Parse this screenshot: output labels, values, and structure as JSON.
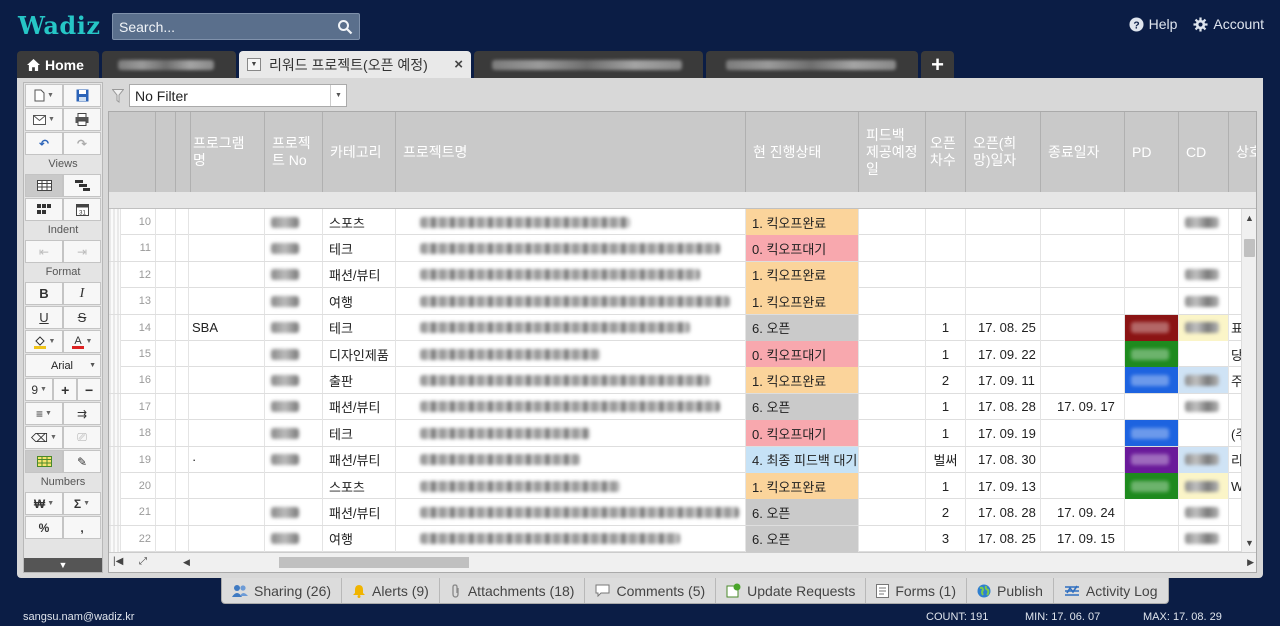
{
  "app": {
    "logo": "Wadiz"
  },
  "search": {
    "placeholder": "Search..."
  },
  "top_links": {
    "help": "Help",
    "account": "Account"
  },
  "tabs": {
    "home": "Home",
    "active": "리워드 프로젝트(오픈 예정)"
  },
  "filter": {
    "value": "No Filter"
  },
  "toolbar": {
    "views": "Views",
    "indent": "Indent",
    "format": "Format",
    "font": "Arial",
    "font_size": "9",
    "numbers": "Numbers"
  },
  "columns": [
    "프로그램명",
    "프로젝트 No",
    "카테고리",
    "프로젝트명",
    "현 진행상태",
    "피드백 제공예정일",
    "오픈차수",
    "오픈(희망)일자",
    "종료일자",
    "PD",
    "CD",
    "상호"
  ],
  "rows": [
    {
      "num": "10",
      "program": "",
      "category": "스포츠",
      "status": "1. 킥오프완료",
      "status_type": "kick-done",
      "round": "",
      "open": "",
      "end": "",
      "pd": "",
      "cd": "blur",
      "extra": ""
    },
    {
      "num": "11",
      "program": "",
      "category": "테크",
      "status": "0. 킥오프대기",
      "status_type": "kick-wait",
      "round": "",
      "open": "",
      "end": "",
      "pd": "",
      "cd": "",
      "extra": ""
    },
    {
      "num": "12",
      "program": "",
      "category": "패션/뷰티",
      "status": "1. 킥오프완료",
      "status_type": "kick-done",
      "round": "",
      "open": "",
      "end": "",
      "pd": "",
      "cd": "blur",
      "extra": ""
    },
    {
      "num": "13",
      "program": "",
      "category": "여행",
      "status": "1. 킥오프완료",
      "status_type": "kick-done",
      "round": "",
      "open": "",
      "end": "",
      "pd": "",
      "cd": "blur",
      "extra": ""
    },
    {
      "num": "14",
      "program": "SBA",
      "category": "테크",
      "status": "6. 오픈",
      "status_type": "open",
      "round": "1",
      "open": "17. 08. 25",
      "end": "",
      "pd": "#8b1414",
      "cd": "#fbf5c8",
      "extra": "표"
    },
    {
      "num": "15",
      "program": "",
      "category": "디자인제품",
      "status": "0. 킥오프대기",
      "status_type": "kick-wait",
      "round": "1",
      "open": "17. 09. 22",
      "end": "",
      "pd": "#1e8a1e",
      "cd": "",
      "extra": "당"
    },
    {
      "num": "16",
      "program": "",
      "category": "출판",
      "status": "1. 킥오프완료",
      "status_type": "kick-done",
      "round": "2",
      "open": "17. 09. 11",
      "end": "",
      "pd": "#1d63e0",
      "cd": "#cfe3f5",
      "extra": "주"
    },
    {
      "num": "17",
      "program": "",
      "category": "패션/뷰티",
      "status": "6. 오픈",
      "status_type": "open",
      "round": "1",
      "open": "17. 08. 28",
      "end": "17. 09. 17",
      "pd": "",
      "cd": "blur",
      "extra": ""
    },
    {
      "num": "18",
      "program": "",
      "category": "테크",
      "status": "0. 킥오프대기",
      "status_type": "kick-wait",
      "round": "1",
      "open": "17. 09. 19",
      "end": "",
      "pd": "#1d63e0",
      "cd": "",
      "extra": "(주"
    },
    {
      "num": "19",
      "program": "·",
      "category": "패션/뷰티",
      "status": "4. 최종 피드백 대기",
      "status_type": "feedback",
      "round": "벌써",
      "open": "17. 08. 30",
      "end": "",
      "pd": "#6a1a9a",
      "cd": "#cfe3f5",
      "extra": "리"
    },
    {
      "num": "20",
      "program": "",
      "category": "스포츠",
      "status": "1. 킥오프완료",
      "status_type": "kick-done",
      "round": "1",
      "open": "17. 09. 13",
      "end": "",
      "pd": "#1e8a1e",
      "cd": "#fbf5c8",
      "extra": "W"
    },
    {
      "num": "21",
      "program": "",
      "category": "패션/뷰티",
      "status": "6. 오픈",
      "status_type": "open",
      "round": "2",
      "open": "17. 08. 28",
      "end": "17. 09. 24",
      "pd": "",
      "cd": "blur",
      "extra": ""
    },
    {
      "num": "22",
      "program": "",
      "category": "여행",
      "status": "6. 오픈",
      "status_type": "open",
      "round": "3",
      "open": "17. 08. 25",
      "end": "17. 09. 15",
      "pd": "",
      "cd": "blur",
      "extra": ""
    }
  ],
  "bottom_tabs": [
    {
      "label": "Sharing (26)",
      "icon": "people-icon"
    },
    {
      "label": "Alerts (9)",
      "icon": "bell-icon"
    },
    {
      "label": "Attachments (18)",
      "icon": "paperclip-icon"
    },
    {
      "label": "Comments (5)",
      "icon": "comment-icon"
    },
    {
      "label": "Update Requests",
      "icon": "update-request-icon"
    },
    {
      "label": "Forms (1)",
      "icon": "form-icon"
    },
    {
      "label": "Publish",
      "icon": "globe-icon"
    },
    {
      "label": "Activity Log",
      "icon": "activity-icon"
    }
  ],
  "status_bar": {
    "user": "sangsu.nam@wadiz.kr",
    "count": "COUNT: 191",
    "min": "MIN: 17. 06. 07",
    "max": "MAX: 17. 08. 29"
  },
  "colors": {
    "background": "#0b1d45",
    "logo": "#26c6c6",
    "kick_done": "#fbd49b",
    "kick_wait": "#f8a8ae",
    "open": "#cacaca",
    "feedback": "#c6e2f6"
  }
}
